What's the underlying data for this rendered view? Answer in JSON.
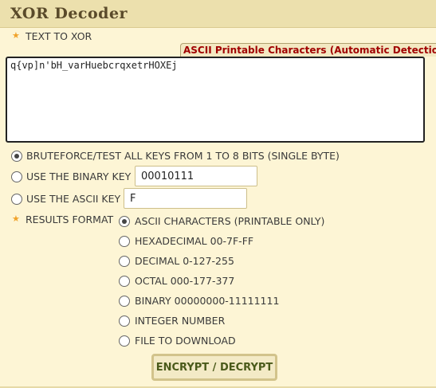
{
  "header": {
    "title": "XOR Decoder"
  },
  "input": {
    "label": "TEXT TO XOR",
    "detect_badge": "ASCII Printable Characters (Automatic Detection)",
    "value": "q{vp]n'bH_varHuebcrqxetrHOXEj"
  },
  "key_mode": {
    "bruteforce_label": "BRUTEFORCE/TEST ALL KEYS FROM 1 TO 8 BITS (SINGLE BYTE)",
    "binary_label": "USE THE BINARY KEY",
    "binary_value": "00010111",
    "ascii_label": "USE THE ASCII KEY",
    "ascii_value": "F",
    "selected": "bruteforce"
  },
  "results": {
    "label": "RESULTS FORMAT",
    "options": [
      "ASCII CHARACTERS (PRINTABLE ONLY)",
      "HEXADECIMAL 00-7F-FF",
      "DECIMAL 0-127-255",
      "OCTAL 000-177-377",
      "BINARY 00000000-11111111",
      "INTEGER NUMBER",
      "FILE TO DOWNLOAD"
    ],
    "selected_index": 0
  },
  "action": {
    "submit_label": "ENCRYPT / DECRYPT"
  },
  "colors": {
    "background": "#fdf5d5",
    "header": "#ece0ad",
    "badge_text": "#a00000",
    "star": "#f0a22a",
    "button_text": "#4a5a1a"
  },
  "icons": {
    "required": "star-icon",
    "radio": "radio-button"
  }
}
